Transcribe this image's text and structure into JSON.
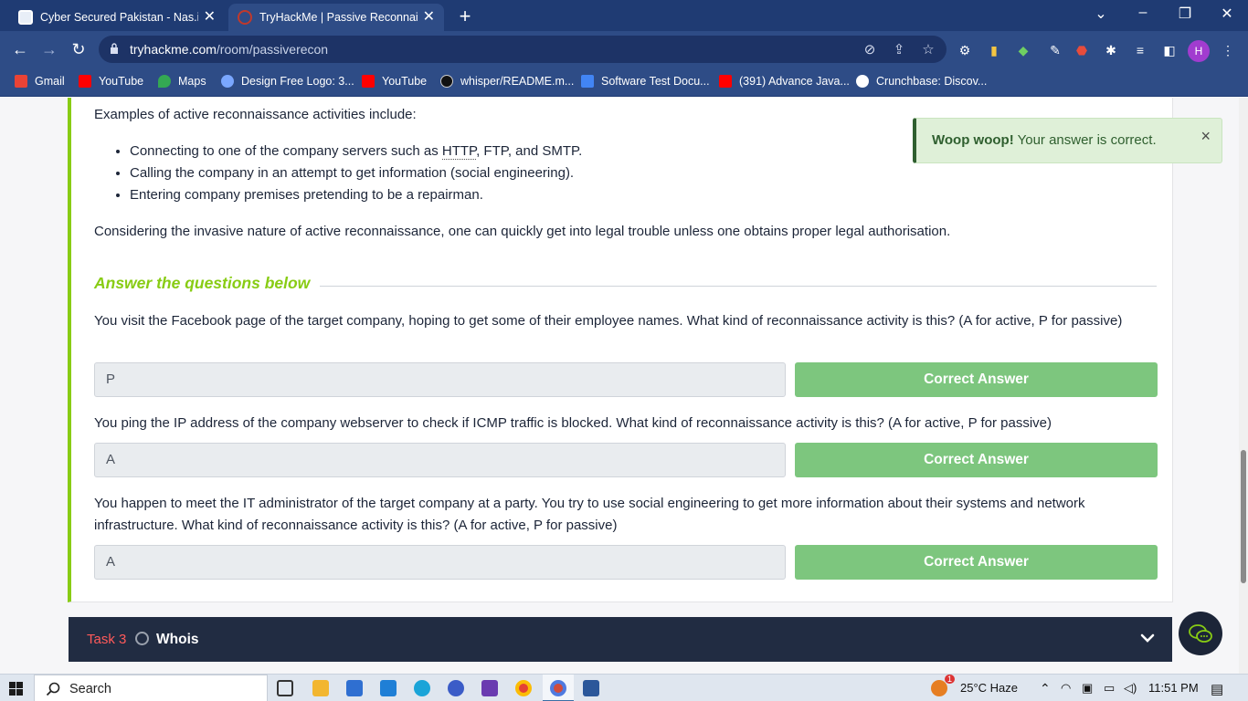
{
  "browser": {
    "tabs": [
      {
        "title": "Cyber Secured Pakistan - Nas.io N",
        "favicon": "nasio-favicon"
      },
      {
        "title": "TryHackMe | Passive Reconnaissa",
        "favicon": "tryhackme-favicon",
        "active": true
      }
    ],
    "new_tab_symbol": "+",
    "url_host": "tryhackme.com",
    "url_path": "/room/passiverecon",
    "profile_initial": "H"
  },
  "bookmarks": [
    {
      "label": "Gmail",
      "icon": "gmail-icon",
      "color": "#ea4335"
    },
    {
      "label": "YouTube",
      "icon": "youtube-icon",
      "color": "#ff0000"
    },
    {
      "label": "Maps",
      "icon": "maps-icon",
      "color": "#34a853"
    },
    {
      "label": "Design Free Logo: 3...",
      "icon": "logo-site-icon",
      "color": "#7aa7ff"
    },
    {
      "label": "YouTube",
      "icon": "youtube-icon",
      "color": "#ff0000"
    },
    {
      "label": "whisper/README.m...",
      "icon": "github-icon",
      "color": "#111111"
    },
    {
      "label": "Software Test Docu...",
      "icon": "google-docs-icon",
      "color": "#4285f4"
    },
    {
      "label": "(391) Advance Java...",
      "icon": "youtube-icon",
      "color": "#ff0000"
    },
    {
      "label": "Crunchbase: Discov...",
      "icon": "globe-icon",
      "color": "#ffffff"
    }
  ],
  "content": {
    "intro": "Examples of active reconnaissance activities include:",
    "bullets": [
      {
        "before": "Connecting to one of the company servers such as ",
        "underlined": "HTTP",
        "after": ", FTP, and SMTP."
      },
      {
        "before": "Calling the company in an attempt to get information (social engineering).",
        "underlined": "",
        "after": ""
      },
      {
        "before": "Entering company premises pretending to be a repairman.",
        "underlined": "",
        "after": ""
      }
    ],
    "paragraph": "Considering the invasive nature of active reconnaissance, one can quickly get into legal trouble unless one obtains proper legal authorisation.",
    "answer_heading": "Answer the questions below",
    "questions": [
      {
        "text": "You visit the Facebook page of the target company, hoping to get some of their employee names. What kind of reconnaissance activity is this? (A for active, P for passive)",
        "answer": "P",
        "button": "Correct Answer"
      },
      {
        "text": "You ping the IP address of the company webserver to check if ICMP traffic is blocked. What kind of reconnaissance activity is this? (A for active, P for passive)",
        "answer": "A",
        "button": "Correct Answer"
      },
      {
        "text": "You happen to meet the IT administrator of the target company at a party. You try to use social engineering to get more information about their systems and network infrastructure. What kind of reconnaissance activity is this? (A for active, P for passive)",
        "answer": "A",
        "button": "Correct Answer"
      }
    ],
    "toast": {
      "strong": "Woop woop!",
      "text": " Your answer is correct.",
      "close": "×"
    },
    "task": {
      "number": "Task 3",
      "title": "Whois"
    }
  },
  "colors": {
    "accent_green": "#88cc14",
    "correct_button": "#7dc67e",
    "task_bar": "#212c42",
    "task_number": "#ff5a5a"
  },
  "taskbar": {
    "search_label": "Search",
    "weather": "25°C  Haze",
    "weather_badge": "1",
    "time": "11:51 PM"
  }
}
